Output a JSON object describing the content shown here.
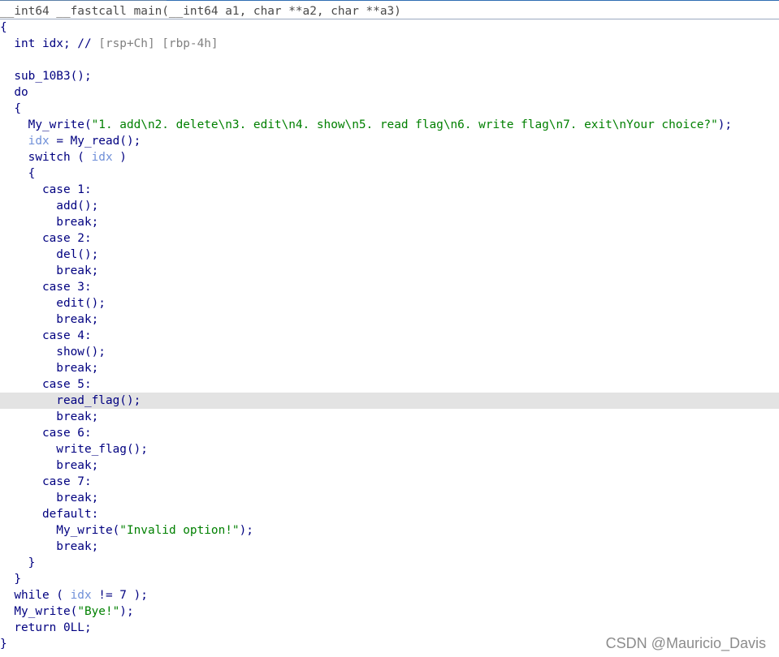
{
  "watermark": "CSDN @Mauricio_Davis",
  "lines": [
    {
      "tokens": [
        {
          "t": "__int64 __fastcall main(__int64 a1, char **a2, char **a3)",
          "c": "sig"
        }
      ]
    },
    {
      "tokens": [
        {
          "t": "{",
          "c": "plain"
        }
      ]
    },
    {
      "tokens": [
        {
          "t": "  int idx; // ",
          "c": "plain"
        },
        {
          "t": "[rsp+Ch] [rbp-4h]",
          "c": "cm"
        }
      ]
    },
    {
      "tokens": [
        {
          "t": "",
          "c": "plain"
        }
      ]
    },
    {
      "tokens": [
        {
          "t": "  sub_10B3();",
          "c": "plain"
        }
      ]
    },
    {
      "tokens": [
        {
          "t": "  do",
          "c": "plain"
        }
      ]
    },
    {
      "tokens": [
        {
          "t": "  {",
          "c": "plain"
        }
      ]
    },
    {
      "tokens": [
        {
          "t": "    My_write(",
          "c": "plain"
        },
        {
          "t": "\"1. add\\n2. delete\\n3. edit\\n4. show\\n5. read flag\\n6. write flag\\n7. exit\\nYour choice?\"",
          "c": "str"
        },
        {
          "t": ");",
          "c": "plain"
        }
      ]
    },
    {
      "tokens": [
        {
          "t": "    ",
          "c": "plain"
        },
        {
          "t": "idx",
          "c": "var"
        },
        {
          "t": " = My_read();",
          "c": "plain"
        }
      ]
    },
    {
      "tokens": [
        {
          "t": "    switch ( ",
          "c": "plain"
        },
        {
          "t": "idx",
          "c": "var"
        },
        {
          "t": " )",
          "c": "plain"
        }
      ]
    },
    {
      "tokens": [
        {
          "t": "    {",
          "c": "plain"
        }
      ]
    },
    {
      "tokens": [
        {
          "t": "      case 1:",
          "c": "plain"
        }
      ]
    },
    {
      "tokens": [
        {
          "t": "        add();",
          "c": "plain"
        }
      ]
    },
    {
      "tokens": [
        {
          "t": "        break;",
          "c": "plain"
        }
      ]
    },
    {
      "tokens": [
        {
          "t": "      case 2:",
          "c": "plain"
        }
      ]
    },
    {
      "tokens": [
        {
          "t": "        del();",
          "c": "plain"
        }
      ]
    },
    {
      "tokens": [
        {
          "t": "        break;",
          "c": "plain"
        }
      ]
    },
    {
      "tokens": [
        {
          "t": "      case 3:",
          "c": "plain"
        }
      ]
    },
    {
      "tokens": [
        {
          "t": "        edit();",
          "c": "plain"
        }
      ]
    },
    {
      "tokens": [
        {
          "t": "        break;",
          "c": "plain"
        }
      ]
    },
    {
      "tokens": [
        {
          "t": "      case 4:",
          "c": "plain"
        }
      ]
    },
    {
      "tokens": [
        {
          "t": "        show();",
          "c": "plain"
        }
      ]
    },
    {
      "tokens": [
        {
          "t": "        break;",
          "c": "plain"
        }
      ]
    },
    {
      "tokens": [
        {
          "t": "      case 5:",
          "c": "plain"
        }
      ]
    },
    {
      "tokens": [
        {
          "t": "        read_flag();",
          "c": "plain"
        }
      ],
      "highlight": true
    },
    {
      "tokens": [
        {
          "t": "        break;",
          "c": "plain"
        }
      ]
    },
    {
      "tokens": [
        {
          "t": "      case 6:",
          "c": "plain"
        }
      ]
    },
    {
      "tokens": [
        {
          "t": "        write_flag();",
          "c": "plain"
        }
      ]
    },
    {
      "tokens": [
        {
          "t": "        break;",
          "c": "plain"
        }
      ]
    },
    {
      "tokens": [
        {
          "t": "      case 7:",
          "c": "plain"
        }
      ]
    },
    {
      "tokens": [
        {
          "t": "        break;",
          "c": "plain"
        }
      ]
    },
    {
      "tokens": [
        {
          "t": "      default:",
          "c": "plain"
        }
      ]
    },
    {
      "tokens": [
        {
          "t": "        My_write(",
          "c": "plain"
        },
        {
          "t": "\"Invalid option!\"",
          "c": "str"
        },
        {
          "t": ");",
          "c": "plain"
        }
      ]
    },
    {
      "tokens": [
        {
          "t": "        break;",
          "c": "plain"
        }
      ]
    },
    {
      "tokens": [
        {
          "t": "    }",
          "c": "plain"
        }
      ]
    },
    {
      "tokens": [
        {
          "t": "  }",
          "c": "plain"
        }
      ]
    },
    {
      "tokens": [
        {
          "t": "  while ( ",
          "c": "plain"
        },
        {
          "t": "idx",
          "c": "var"
        },
        {
          "t": " != 7 );",
          "c": "plain"
        }
      ]
    },
    {
      "tokens": [
        {
          "t": "  My_write(",
          "c": "plain"
        },
        {
          "t": "\"Bye!\"",
          "c": "str"
        },
        {
          "t": ");",
          "c": "plain"
        }
      ]
    },
    {
      "tokens": [
        {
          "t": "  return 0LL;",
          "c": "plain"
        }
      ]
    },
    {
      "tokens": [
        {
          "t": "}",
          "c": "plain"
        }
      ]
    }
  ]
}
